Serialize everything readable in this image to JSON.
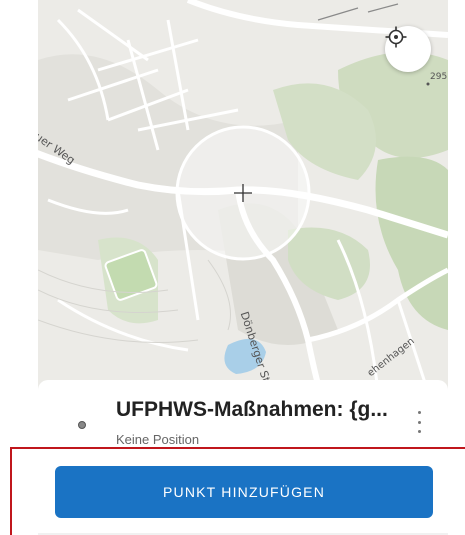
{
  "map": {
    "labels": {
      "road_weg": "uer Weg",
      "road_doenberger": "Dönberger Straß",
      "road_hagen": "ehenhagen",
      "height": "295"
    }
  },
  "layer": {
    "title": "UFPHWS-Maßnahmen: {g...",
    "subtitle": "Keine Position"
  },
  "actions": {
    "add_point_label": "PUNKT HINZUFÜGEN"
  },
  "colors": {
    "accent": "#1a73c4",
    "highlight": "#c0161c"
  }
}
